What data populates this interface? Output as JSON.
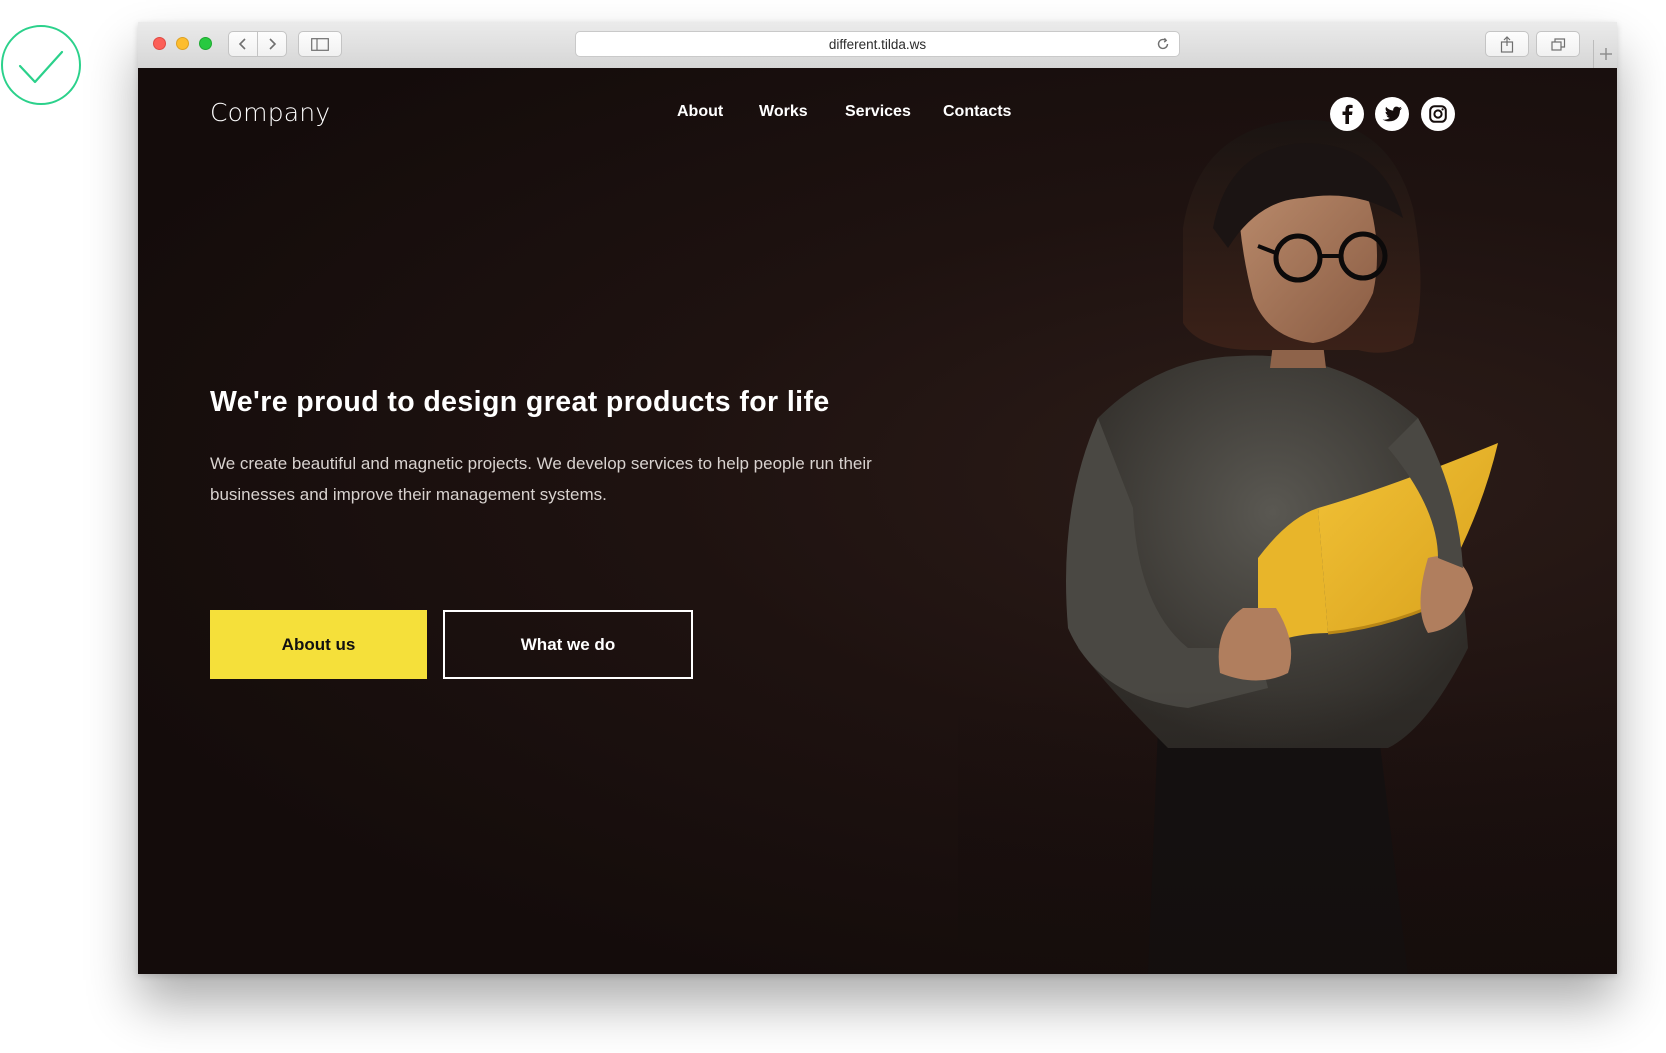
{
  "browser": {
    "url": "different.tilda.ws"
  },
  "site": {
    "logo": "Company",
    "nav": [
      "About",
      "Works",
      "Services",
      "Contacts"
    ],
    "social": [
      "facebook-icon",
      "twitter-icon",
      "instagram-icon"
    ]
  },
  "hero": {
    "headline": "We're proud to design great products for life",
    "subtext": "We create beautiful and magnetic projects. We develop services to help people run their businesses and improve their management systems.",
    "primary_button": "About us",
    "secondary_button": "What we do"
  },
  "colors": {
    "accent": "#f5e03a",
    "background": "#150d0c",
    "check": "#2bd18b"
  }
}
